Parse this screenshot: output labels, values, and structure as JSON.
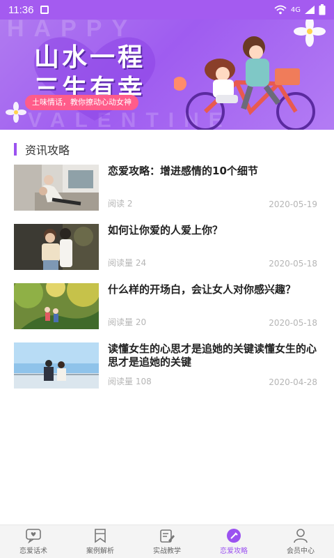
{
  "status_bar": {
    "time": "11:36",
    "network": "4G"
  },
  "banner": {
    "title_line1": "山水一程",
    "title_line2": "三生有幸",
    "tagline": "土味情话，教你撩动心动女神",
    "bg_word_top": "HAPPY",
    "bg_word_bottom": "VALENTINE"
  },
  "section": {
    "title": "资讯攻略"
  },
  "articles": [
    {
      "title": "恋爱攻略：增进感情的10个细节",
      "reads": "阅读 2",
      "date": "2020-05-19",
      "thumb": "couple-sofa"
    },
    {
      "title": "如何让你爱的人爱上你？",
      "reads": "阅读量 24",
      "date": "2020-05-18",
      "thumb": "couple-embrace"
    },
    {
      "title": "什么样的开场白，会让女人对你感兴趣？",
      "reads": "阅读量 20",
      "date": "2020-05-18",
      "thumb": "forest-illustration"
    },
    {
      "title": "读懂女生的心思才是追她的关键读懂女生的心思才是追她的关键",
      "reads": "阅读量 108",
      "date": "2020-04-28",
      "thumb": "couple-seaside"
    }
  ],
  "tabbar": {
    "active": 3,
    "items": [
      {
        "label": "恋爱话术",
        "icon": "chat-heart-icon"
      },
      {
        "label": "案例解析",
        "icon": "bookmark-icon"
      },
      {
        "label": "实战教学",
        "icon": "edit-note-icon"
      },
      {
        "label": "恋爱攻略",
        "icon": "strategy-icon"
      },
      {
        "label": "会员中心",
        "icon": "user-icon"
      }
    ]
  },
  "colors": {
    "accent": "#9b52f0",
    "status_bar": "#a45bf0",
    "tag_pink": "#ff5c8a",
    "meta_gray": "#b5b5b5"
  }
}
